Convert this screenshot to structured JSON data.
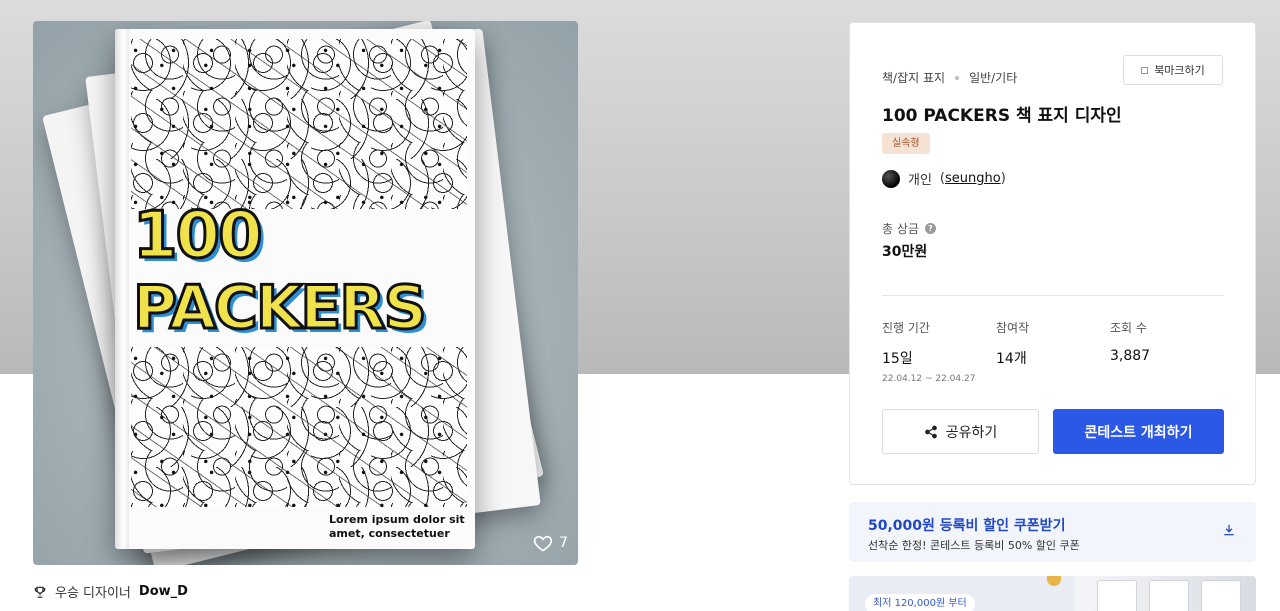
{
  "artwork": {
    "cover_line1": "100",
    "cover_line2": "PACKERS",
    "cover_lorem": "Lorem ipsum dolor sit amet, consectetuer",
    "like_count": "7",
    "like_icon": "heart-icon"
  },
  "winner": {
    "label": "우승 디자이너",
    "name": "Dow_D",
    "icon": "trophy-icon"
  },
  "detail": {
    "category": "책/잡지 표지",
    "subcategory": "일반/기타",
    "bookmark_label": "북마크하기",
    "title": "100 PACKERS 책 표지 디자인",
    "badge": "실속형",
    "owner_type": "개인",
    "owner_username": "seungho",
    "prize_label": "총 상금",
    "prize_value": "30만원",
    "stats": {
      "period_label": "진행 기간",
      "period_value": "15일",
      "period_dates": "22.04.12 ~ 22.04.27",
      "participants_label": "참여작",
      "participants_value": "14개",
      "views_label": "조회 수",
      "views_value": "3,887"
    },
    "share_label": "공유하기",
    "host_label": "콘테스트 개최하기"
  },
  "coupon": {
    "title": "50,000원 등록비 할인 쿠폰받기",
    "subtitle": "선착순 한정! 콘테스트 등록비 50% 할인 쿠폰"
  },
  "promo": {
    "price_tag": "최저 120,000원 부터"
  },
  "colors": {
    "primary": "#2c58e6",
    "badge_bg": "#f6e2d2",
    "badge_text": "#a0562a",
    "coupon_text": "#2048c6"
  }
}
